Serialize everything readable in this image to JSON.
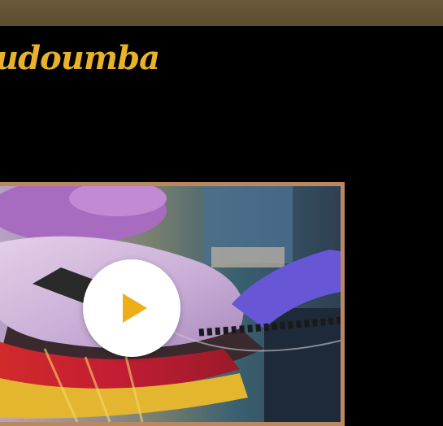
{
  "header": {
    "title": "udoumba"
  },
  "video": {
    "play_icon": "play-icon",
    "accent_color": "#f0ad1a"
  },
  "colors": {
    "top_bar": "#6a5a3a",
    "title": "#e8b22a",
    "frame": "#b98860",
    "background": "#000000"
  }
}
